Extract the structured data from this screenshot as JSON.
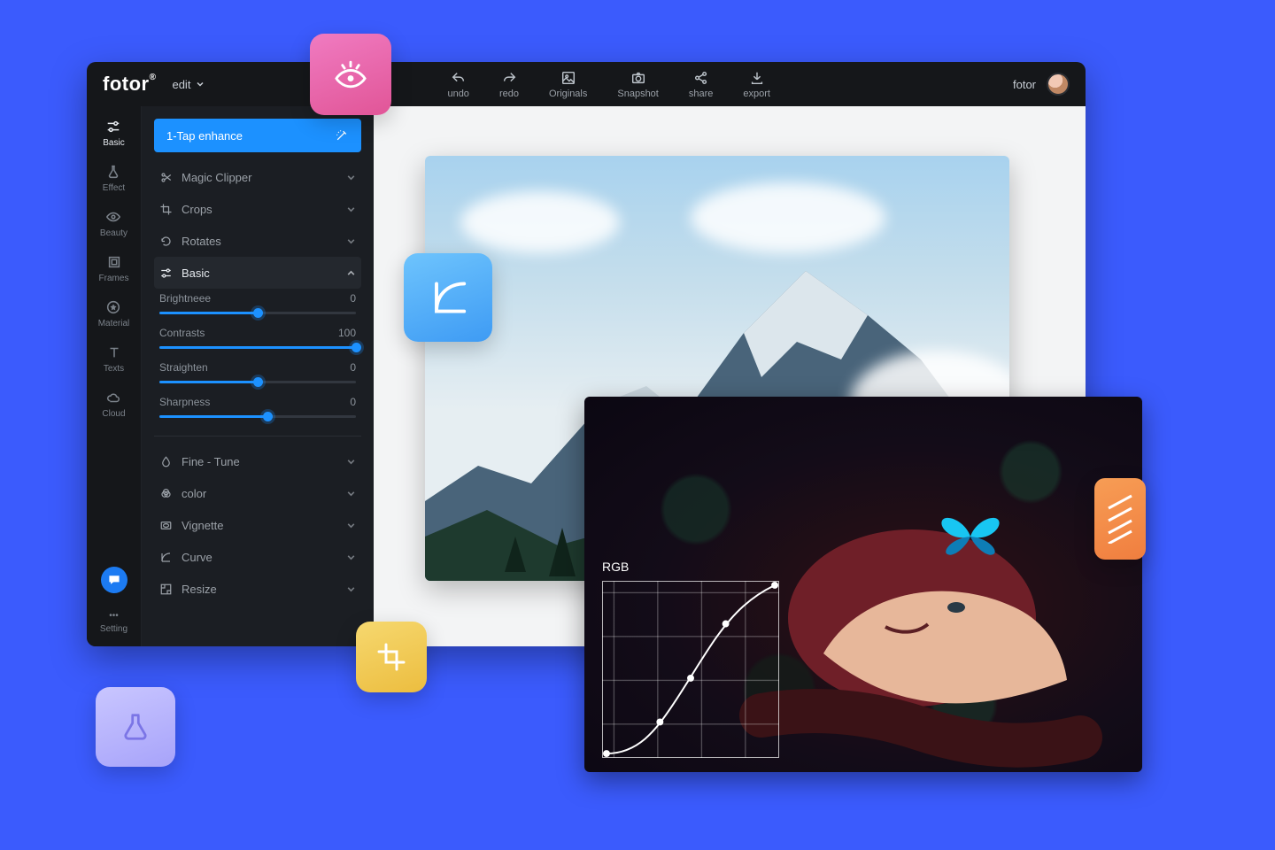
{
  "brand": "fotor",
  "header": {
    "edit_menu": "edit",
    "actions": {
      "undo": "undo",
      "redo": "redo",
      "originals": "Originals",
      "snapshot": "Snapshot",
      "share": "share",
      "export": "export"
    },
    "username": "fotor"
  },
  "rail": {
    "basic": "Basic",
    "effect": "Effect",
    "beauty": "Beauty",
    "frames": "Frames",
    "material": "Material",
    "texts": "Texts",
    "cloud": "Cloud",
    "setting": "Setting"
  },
  "panel": {
    "primary_btn": "1-Tap enhance",
    "magic_clipper": "Magic Clipper",
    "crops": "Crops",
    "rotates": "Rotates",
    "basic": "Basic",
    "fine_tune": "Fine - Tune",
    "color": "color",
    "vignette": "Vignette",
    "curve": "Curve",
    "resize": "Resize",
    "sliders": {
      "brightness": {
        "label": "Brightneee",
        "value": "0",
        "pct": 50
      },
      "contrasts": {
        "label": "Contrasts",
        "value": "100",
        "pct": 100
      },
      "straighten": {
        "label": "Straighten",
        "value": "0",
        "pct": 50
      },
      "sharpness": {
        "label": "Sharpness",
        "value": "0",
        "pct": 55
      }
    }
  },
  "curve_overlay": {
    "title": "RGB"
  },
  "colors": {
    "accent": "#1C91FF",
    "bg_app": "#15171A",
    "bg_panel": "#1B1E23",
    "page": "#3B5BFD"
  }
}
